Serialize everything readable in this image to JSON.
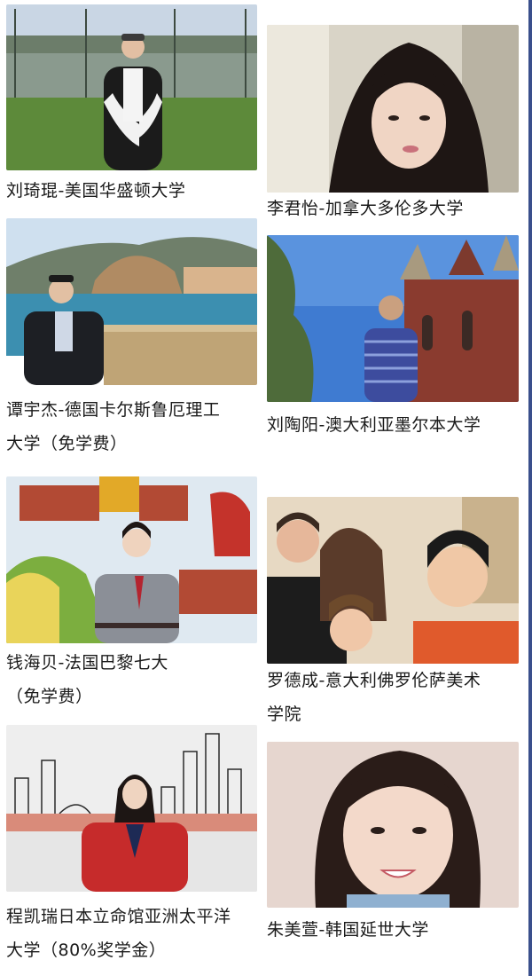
{
  "profiles": [
    {
      "caption_lines": [
        "刘琦琨-美国华盛顿大学"
      ]
    },
    {
      "caption_lines": [
        "李君怡-加拿大多伦多大学"
      ]
    },
    {
      "caption_lines": [
        "谭宇杰-德国卡尔斯鲁厄理工",
        "大学（免学费）"
      ]
    },
    {
      "caption_lines": [
        "刘陶阳-澳大利亚墨尔本大学"
      ]
    },
    {
      "caption_lines": [
        "钱海贝-法国巴黎七大",
        "（免学费）"
      ]
    },
    {
      "caption_lines": [
        "罗德成-意大利佛罗伦萨美术",
        "学院"
      ]
    },
    {
      "caption_lines": [
        "程凯瑞日本立命馆亚洲太平洋",
        "大学（80%奖学金）"
      ]
    },
    {
      "caption_lines": [
        "朱美萱-韩国延世大学"
      ]
    }
  ],
  "colors": {
    "accent_rule": "#3a4f8c"
  }
}
